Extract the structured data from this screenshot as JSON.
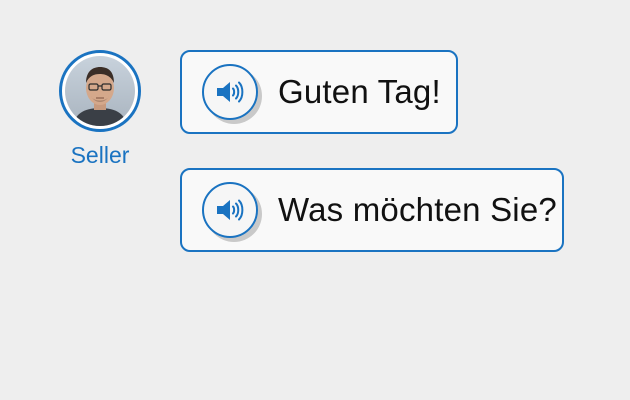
{
  "speaker": {
    "name": "Seller"
  },
  "messages": [
    {
      "text": "Guten Tag!"
    },
    {
      "text": "Was möchten Sie?"
    }
  ],
  "colors": {
    "accent": "#1a73c1",
    "background": "#eeeeee",
    "bubble_background": "#f9f9f9",
    "text": "#111111"
  },
  "icons": {
    "audio": "speaker-volume-icon"
  }
}
